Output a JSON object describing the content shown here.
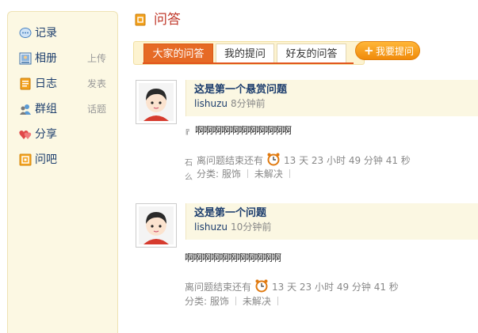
{
  "sidebar": {
    "items": [
      {
        "label": "记录",
        "action": "",
        "icon": "chat-bubble-icon"
      },
      {
        "label": "相册",
        "action": "上传",
        "icon": "photo-album-icon"
      },
      {
        "label": "日志",
        "action": "发表",
        "icon": "journal-icon"
      },
      {
        "label": "群组",
        "action": "话题",
        "icon": "group-icon"
      },
      {
        "label": "分享",
        "action": "",
        "icon": "share-heart-icon"
      },
      {
        "label": "问吧",
        "action": "",
        "icon": "ask-icon"
      }
    ]
  },
  "header": {
    "title": "问答",
    "icon": "qa-icon"
  },
  "tabs": [
    {
      "label": "大家的问答",
      "active": true
    },
    {
      "label": "我的提问",
      "active": false
    },
    {
      "label": "好友的问答",
      "active": false
    }
  ],
  "ask_button": {
    "label": "我要提问"
  },
  "questions": [
    {
      "title": "这是第一个悬赏问题",
      "user": "lishuzu",
      "time": "8分钟前",
      "body": "啊啊啊啊啊啊啊啊啊啊啊",
      "deadline_prefix": "离问题结束还有",
      "countdown": "13 天 23 小时 49 分钟 41 秒",
      "category_label": "分类: 服饰",
      "status": "未解决"
    },
    {
      "title": "这是第一个问题",
      "user": "lishuzu",
      "time": "10分钟前",
      "body": "啊啊啊啊啊啊啊啊啊啊啊",
      "deadline_prefix": "离问题结束还有",
      "countdown": "13 天 23 小时 49 分钟 41 秒",
      "category_label": "分类: 服饰",
      "status": "未解决"
    }
  ],
  "colors": {
    "accent": "#e66a25",
    "link": "#1c3d6d",
    "title": "#c0392b",
    "sidebar_bg": "#fcf8e3"
  }
}
